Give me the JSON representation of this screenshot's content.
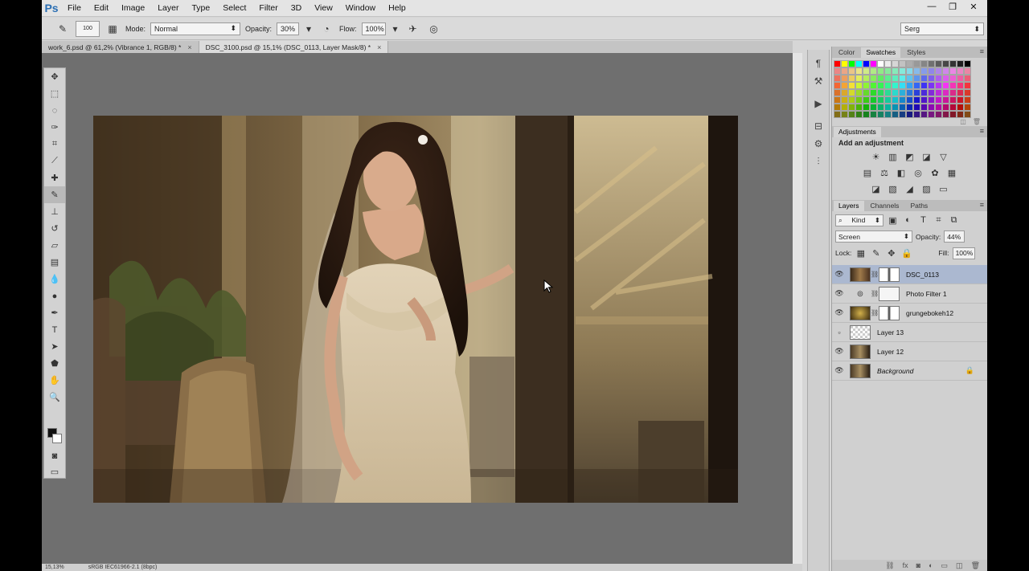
{
  "app": {
    "logo": "Ps"
  },
  "menu": [
    "File",
    "Edit",
    "Image",
    "Layer",
    "Type",
    "Select",
    "Filter",
    "3D",
    "View",
    "Window",
    "Help"
  ],
  "window_controls": {
    "minimize": "—",
    "restore": "❐",
    "close": "✕"
  },
  "options_bar": {
    "brush_size": "100",
    "mode_label": "Mode:",
    "mode_value": "Normal",
    "opacity_label": "Opacity:",
    "opacity_value": "30%",
    "flow_label": "Flow:",
    "flow_value": "100%",
    "workspace": "Serg"
  },
  "tabs": [
    {
      "title": "work_6.psd @ 61,2% (Vibrance 1, RGB/8) *",
      "close": "×"
    },
    {
      "title": "DSC_3100.psd @ 15,1% (DSC_0113, Layer Mask/8) *",
      "close": "×"
    }
  ],
  "status_bar": {
    "zoom": "15,13%",
    "profile": "sRGB IEC61966-2.1 (8bpc)"
  },
  "panels": {
    "color_tabs": [
      "Color",
      "Swatches",
      "Styles"
    ],
    "adjustments_tab": "Adjustments",
    "adjustments_title": "Add an adjustment",
    "layers_tabs": [
      "Layers",
      "Channels",
      "Paths"
    ],
    "filter_kind": "Kind",
    "blend_mode": "Screen",
    "opacity_label": "Opacity:",
    "opacity_value": "44%",
    "lock_label": "Lock:",
    "fill_label": "Fill:",
    "fill_value": "100%"
  },
  "layers": [
    {
      "name": "DSC_0113",
      "visible": true,
      "selected": true
    },
    {
      "name": "Photo Filter 1",
      "visible": true,
      "selected": false
    },
    {
      "name": "grungebokeh12",
      "visible": true,
      "selected": false
    },
    {
      "name": "Layer 13",
      "visible": false,
      "selected": false
    },
    {
      "name": "Layer 12",
      "visible": true,
      "selected": false
    },
    {
      "name": "Background",
      "visible": true,
      "selected": false,
      "locked": true
    }
  ],
  "colors": {
    "foreground": "#111111",
    "background": "#ffffff",
    "selection": "#abb8d0",
    "canvas_bg": "#6f6f6f"
  },
  "icons": {
    "tools": [
      "move-icon",
      "marquee-icon",
      "lasso-icon",
      "quick-select-icon",
      "crop-icon",
      "eyedropper-icon",
      "healing-icon",
      "brush-icon",
      "clone-stamp-icon",
      "history-brush-icon",
      "eraser-icon",
      "gradient-icon",
      "blur-icon",
      "dodge-icon",
      "pen-icon",
      "type-icon",
      "path-select-icon",
      "shape-icon",
      "hand-icon",
      "zoom-icon"
    ]
  }
}
